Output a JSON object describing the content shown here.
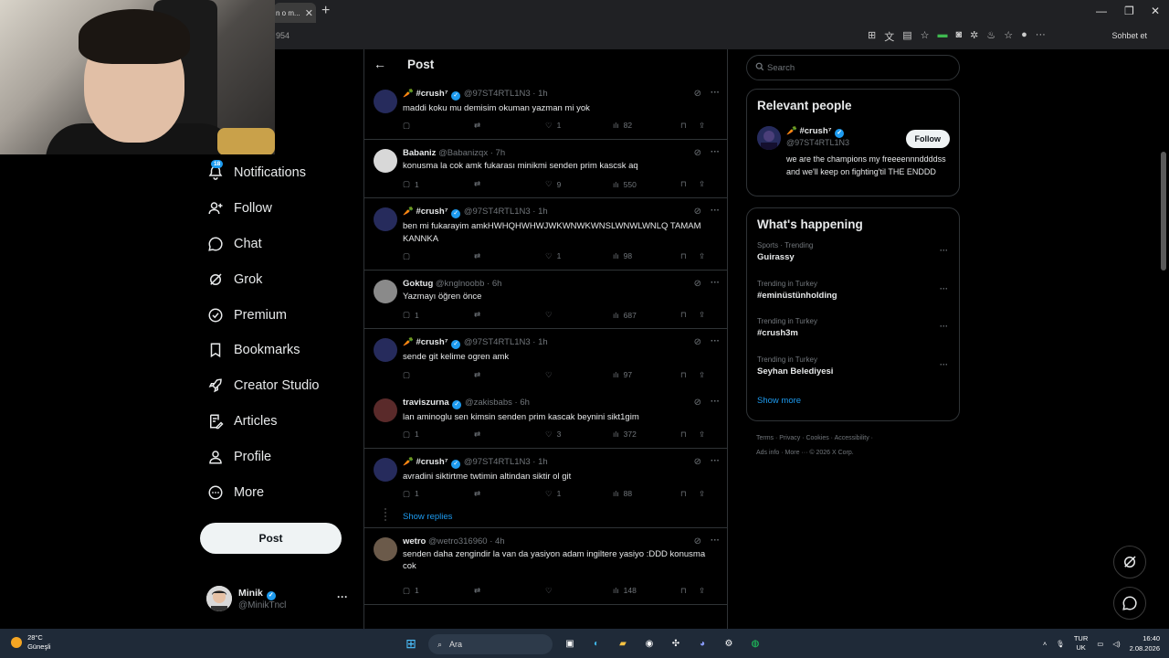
{
  "browser": {
    "tab_title": "n o m...",
    "address": "954",
    "profile_label": "Sohbet et"
  },
  "nav": {
    "notifications_count": "18",
    "items": [
      {
        "label": "Notifications"
      },
      {
        "label": "Follow"
      },
      {
        "label": "Chat"
      },
      {
        "label": "Grok"
      },
      {
        "label": "Premium"
      },
      {
        "label": "Bookmarks"
      },
      {
        "label": "Creator Studio"
      },
      {
        "label": "Articles"
      },
      {
        "label": "Profile"
      },
      {
        "label": "More"
      }
    ],
    "post_label": "Post"
  },
  "account": {
    "name": "Minik",
    "handle": "@MinikTncl"
  },
  "main": {
    "title": "Post"
  },
  "tweets": [
    {
      "name": "🥕 #crush⁷",
      "handle": "@97ST4RTL1N3",
      "time": "1h",
      "text": "maddi koku mu demisim okuman yazman mi yok",
      "replies": "",
      "retweets": "",
      "likes": "1",
      "views": "82"
    },
    {
      "name": "Babaniz",
      "handle": "@Babanizqx",
      "time": "7h",
      "text": "konusma la cok amk fukarası minikmi senden prim kascsk aq",
      "replies": "1",
      "retweets": "",
      "likes": "9",
      "views": "550"
    },
    {
      "name": "🥕 #crush⁷",
      "handle": "@97ST4RTL1N3",
      "time": "1h",
      "text": "ben mi fukarayim amkHWHQHWHWJWKWNWKWNSLWNWLWNLQ TAMAM KANNKA",
      "replies": "",
      "retweets": "",
      "likes": "1",
      "views": "98"
    },
    {
      "name": "Goktug",
      "handle": "@knglnoobb",
      "time": "6h",
      "text": "Yazmayı öğren önce",
      "replies": "1",
      "retweets": "",
      "likes": "",
      "views": "687"
    },
    {
      "name": "🥕 #crush⁷",
      "handle": "@97ST4RTL1N3",
      "time": "1h",
      "text": "sende git kelime ogren amk",
      "replies": "",
      "retweets": "",
      "likes": "",
      "views": "97"
    },
    {
      "name": "traviszurna",
      "handle": "@zakisbabs",
      "time": "6h",
      "text": "lan aminoglu sen kimsin senden prim kascak beynini sikt1gim",
      "replies": "1",
      "retweets": "",
      "likes": "3",
      "views": "372"
    },
    {
      "name": "🥕 #crush⁷",
      "handle": "@97ST4RTL1N3",
      "time": "1h",
      "text": "avradini siktirtme twtimin altindan siktir ol git",
      "replies": "1",
      "retweets": "",
      "likes": "1",
      "views": "88"
    },
    {
      "name": "wetro",
      "handle": "@wetro316960",
      "time": "4h",
      "text": "senden daha zengindir la van da yasiyon adam ingiltere yasiyo :DDD konusma cok",
      "replies": "1",
      "retweets": "",
      "likes": "",
      "views": "148"
    }
  ],
  "show_replies": "Show replies",
  "right": {
    "search_placeholder": "Search",
    "relevant_title": "Relevant people",
    "relevant_name": "🥕 #crush⁷",
    "relevant_handle": "@97ST4RTL1N3",
    "relevant_bio": "we are the champions my freeeennnddddss and we'll keep on fighting'til THE ENDDD",
    "follow_label": "Follow",
    "happening_title": "What's happening",
    "trends": [
      {
        "category": "Sports · Trending",
        "name": "Guirassy"
      },
      {
        "category": "Trending in Turkey",
        "name": "#eminüstünholding"
      },
      {
        "category": "Trending in Turkey",
        "name": "#crush3m"
      },
      {
        "category": "Trending in Turkey",
        "name": "Seyhan Belediyesi"
      }
    ],
    "show_more": "Show more",
    "footer_line1": "Terms · Privacy · Cookies · Accessibility ·",
    "footer_line2": "Ads info · More ··· © 2026 X Corp."
  },
  "taskbar": {
    "temp": "28°C",
    "weather": "Güneşli",
    "search": "Ara",
    "lang1": "TUR",
    "lang2": "UK",
    "time": "16:40",
    "date": "2.08.2026"
  },
  "colors": {
    "accent": "#1d9bf0",
    "background": "#000000",
    "border": "#2f3336"
  }
}
